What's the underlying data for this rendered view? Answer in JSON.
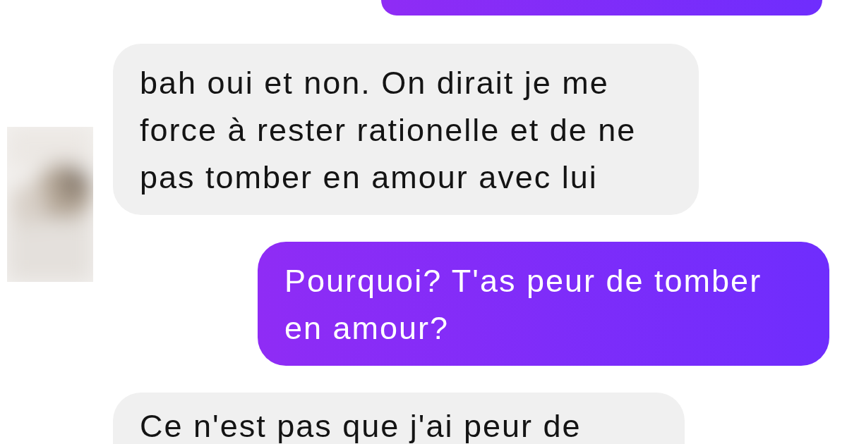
{
  "messages": [
    {
      "kind": "sent"
    },
    {
      "kind": "received",
      "text": "bah oui et non. On dirait je me force à rester rationelle et de ne pas tomber en amour avec lui"
    },
    {
      "kind": "sent",
      "text": "Pourquoi? T'as peur de tomber en amour?"
    },
    {
      "kind": "received",
      "text": "Ce n'est pas que j'ai peur de"
    }
  ]
}
